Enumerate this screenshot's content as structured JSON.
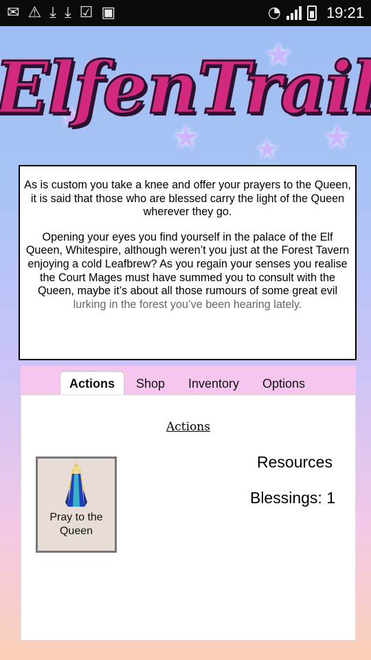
{
  "status_bar": {
    "time": "19:21",
    "icons": [
      "gmail-icon",
      "warning-icon",
      "download-icon",
      "download-icon",
      "clipboard-check-icon",
      "no-sim-icon",
      "wifi-icon",
      "signal-icon",
      "battery-icon"
    ]
  },
  "logo": {
    "text": "ElfenTrail"
  },
  "story": {
    "paragraph1": "As is custom you take a knee and offer your prayers to the Queen, it is said that those who are blessed carry the light of the Queen wherever they go.",
    "paragraph2": "Opening your eyes you find yourself in the palace of the Elf Queen, Whitespire, although weren’t you just at the Forest Tavern enjoying a cold Leafbrew? As you regain your senses you realise the Court Mages must have summed you to consult with the Queen, maybe it’s about all those rumours of some great evil",
    "paragraph2_fade": "lurking in the forest you’ve been hearing lately."
  },
  "tabs": [
    {
      "label": "Actions",
      "active": true
    },
    {
      "label": "Shop",
      "active": false
    },
    {
      "label": "Inventory",
      "active": false
    },
    {
      "label": "Options",
      "active": false
    }
  ],
  "actions_panel": {
    "title": "Actions",
    "action": {
      "label": "Pray to the Queen"
    }
  },
  "resources": {
    "title": "Resources",
    "blessings_text": "Blessings: 1"
  },
  "colors": {
    "logo": "#d2297e",
    "tab_bar": "#f7c6ef",
    "card": "#e8ddd6"
  }
}
